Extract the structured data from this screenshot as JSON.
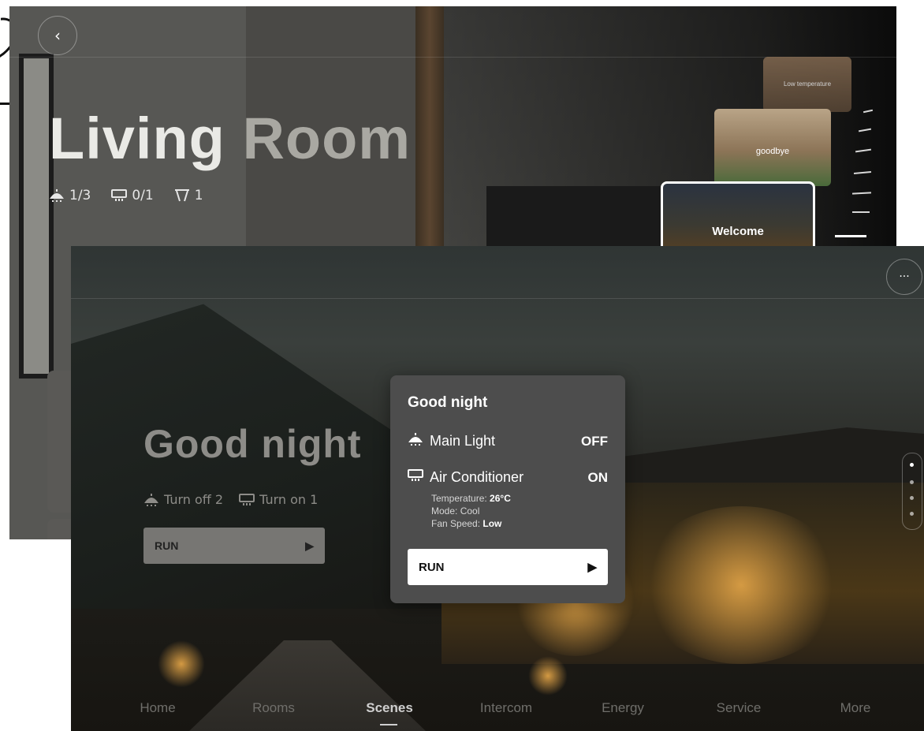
{
  "back_panel": {
    "title": {
      "primary": "Living",
      "secondary": "Room"
    },
    "stats": [
      {
        "icon": "ceiling-lamp-icon",
        "value": "1/3"
      },
      {
        "icon": "air-conditioner-icon",
        "value": "0/1"
      },
      {
        "icon": "curtain-icon",
        "value": "1"
      }
    ],
    "scene_cards": [
      {
        "label": "Low temperature"
      },
      {
        "label": "goodbye"
      },
      {
        "label": "Welcome"
      }
    ]
  },
  "front_panel": {
    "scene_title": "Good night",
    "scene_stats": [
      {
        "icon": "ceiling-lamp-icon",
        "label": "Turn off 2"
      },
      {
        "icon": "air-conditioner-icon",
        "label": "Turn on 1"
      }
    ],
    "run_label": "RUN",
    "more_label": "···",
    "nav": [
      {
        "label": "Home"
      },
      {
        "label": "Rooms"
      },
      {
        "label": "Scenes"
      },
      {
        "label": "Intercom"
      },
      {
        "label": "Energy"
      },
      {
        "label": "Service"
      },
      {
        "label": "More"
      }
    ],
    "active_nav": "Scenes"
  },
  "popup": {
    "title": "Good night",
    "devices": [
      {
        "name": "Main Light",
        "state": "OFF"
      },
      {
        "name": "Air Conditioner",
        "state": "ON"
      }
    ],
    "details": {
      "temperature_label": "Temperature:",
      "temperature_value": "26°C",
      "mode_label": "Mode:",
      "mode_value": "Cool",
      "fan_label": "Fan Speed:",
      "fan_value": "Low"
    },
    "run_label": "RUN"
  },
  "colors": {
    "accent": "#ffffff",
    "popup_bg": "#4d4d4d",
    "dim_text": "#8d8c88"
  }
}
